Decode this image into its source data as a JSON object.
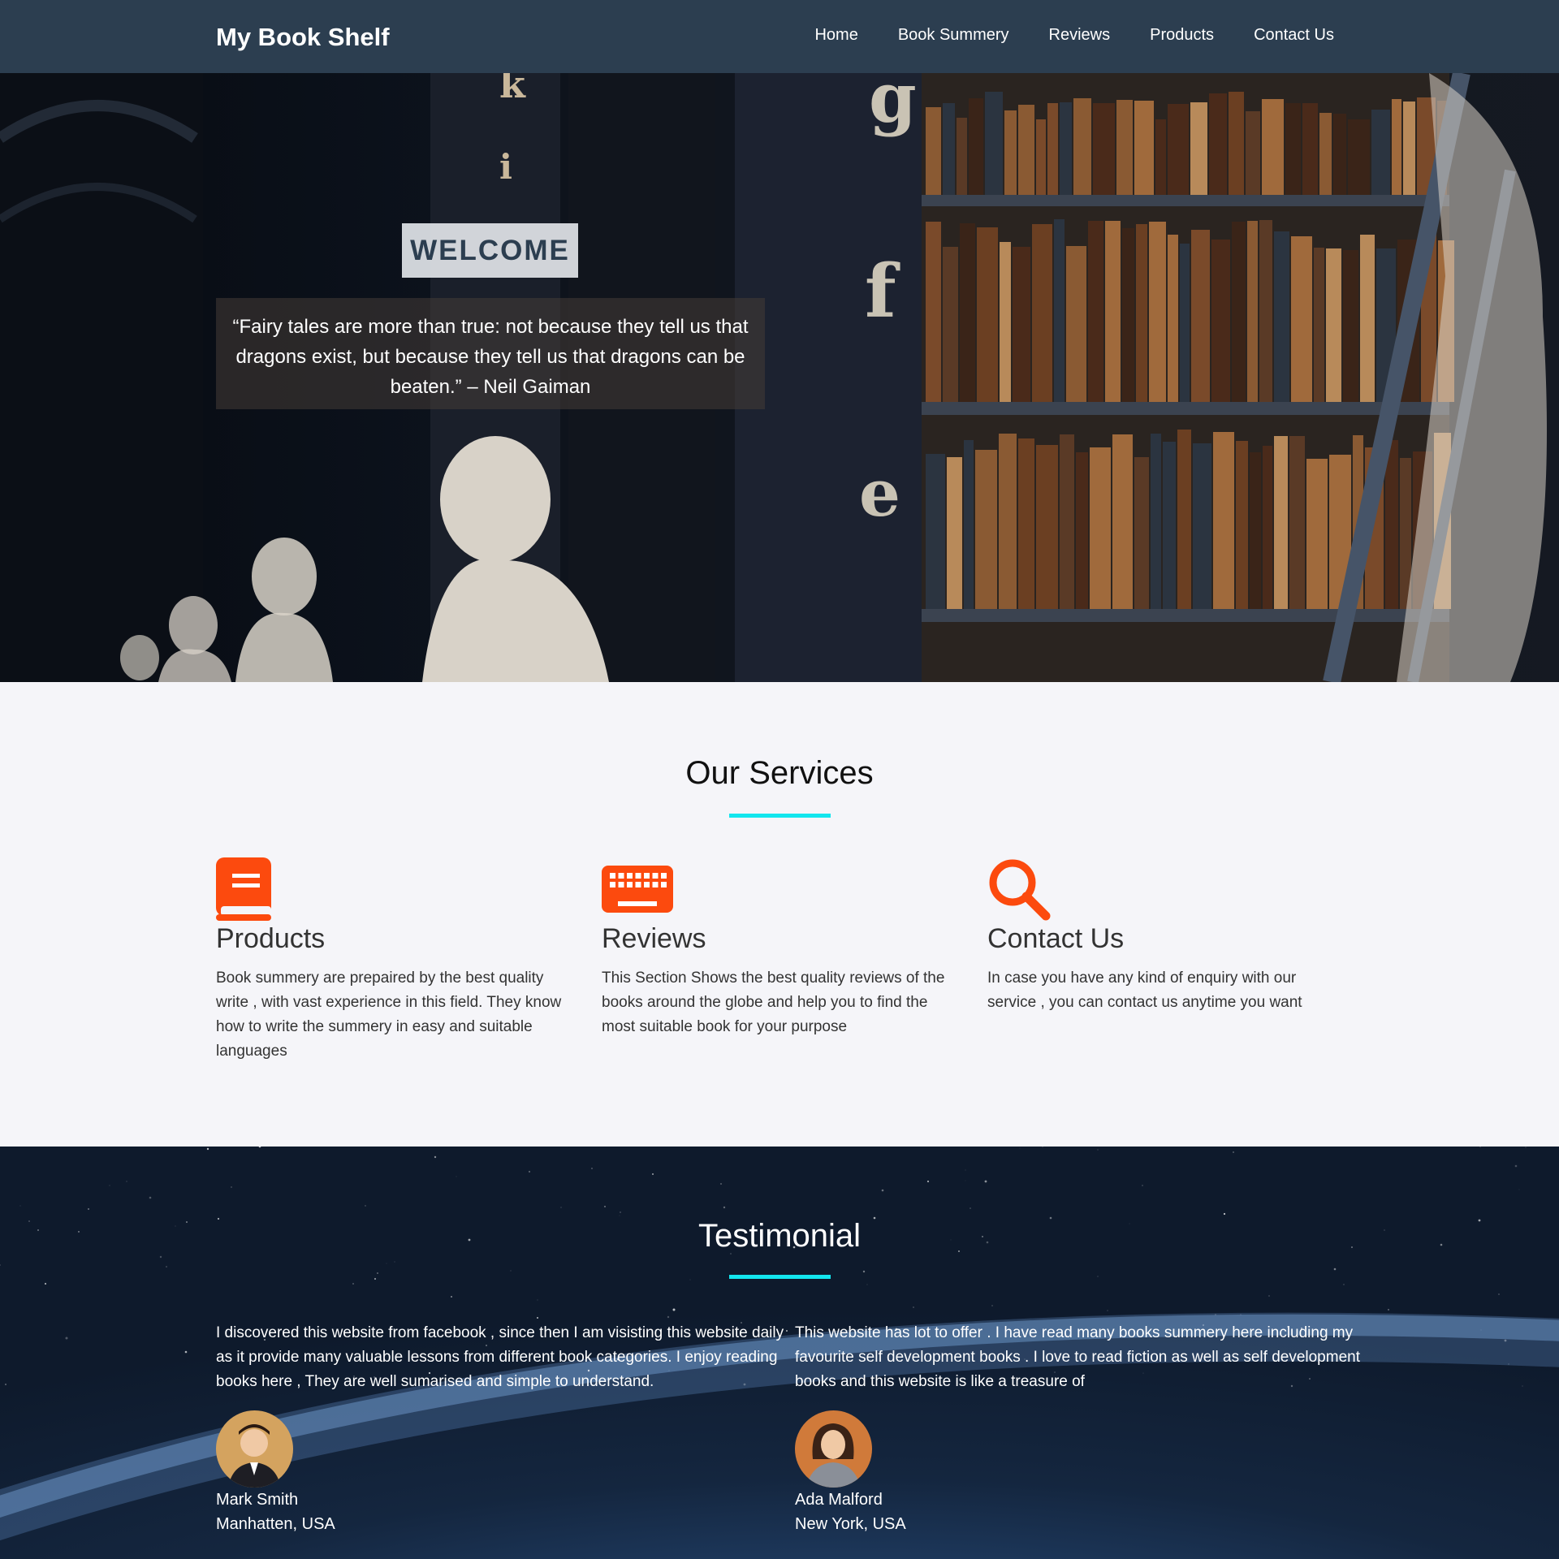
{
  "nav": {
    "brand": "My Book Shelf",
    "links": [
      "Home",
      "Book Summery",
      "Reviews",
      "Products",
      "Contact Us"
    ]
  },
  "hero": {
    "welcome": "WELCOME",
    "quote": "“Fairy tales are more than true: not because they tell us that dragons exist, but because they tell us that dragons can be beaten.” – Neil Gaiman"
  },
  "services": {
    "title": "Our Services",
    "items": [
      {
        "icon": "book-icon",
        "title": "Products",
        "text": "Book summery are prepaired by the best quality write , with vast experience in this field. They know how to write the summery in easy and suitable languages"
      },
      {
        "icon": "keyboard-icon",
        "title": "Reviews",
        "text": "This Section Shows the best quality reviews of the books around the globe and help you to find the most suitable book for your purpose"
      },
      {
        "icon": "search-icon",
        "title": "Contact Us",
        "text": "In case you have any kind of enquiry with our service , you can contact us anytime you want"
      }
    ]
  },
  "testimonial": {
    "title": "Testimonial",
    "items": [
      {
        "text": "I discovered this website from facebook , since then I am visisting this website daily as it provide many valuable lessons from different book categories. I enjoy reading books here , They are well sumarised and simple to understand.",
        "name": "Mark Smith",
        "location": "Manhatten, USA"
      },
      {
        "text": "This website has lot to offer . I have read many books summery here including my favourite self development books . I love to read fiction as well as self development books and this website is like a treasure of",
        "name": "Ada Malford",
        "location": "New York, USA"
      }
    ]
  },
  "colors": {
    "nav_bg": "#2c3e50",
    "accent": "#13e6ee",
    "icon_orange": "#fc4a0e"
  }
}
